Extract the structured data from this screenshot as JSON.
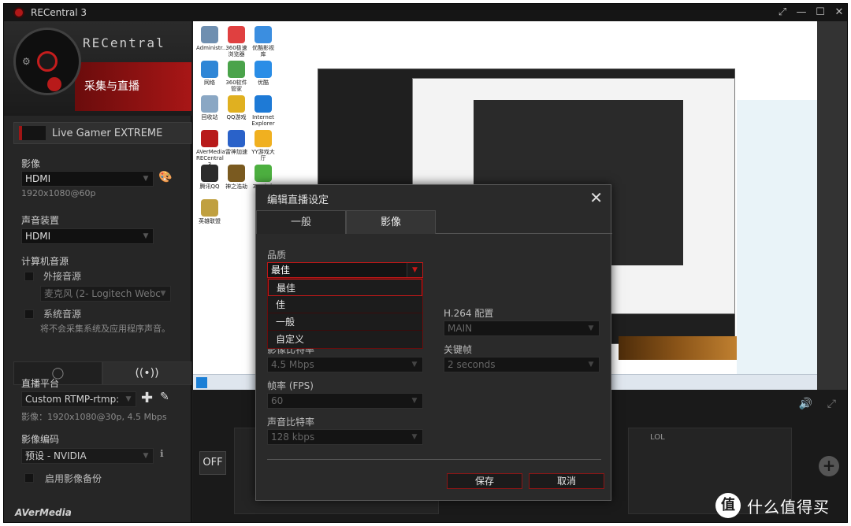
{
  "window": {
    "title": "RECentral 3",
    "controls": [
      "⤢",
      "—",
      "☐",
      "✕"
    ]
  },
  "brand": {
    "logo": "RECentral",
    "subtitle": "采集与直播"
  },
  "device": {
    "name": "Live Gamer EXTREME"
  },
  "left": {
    "video_label": "影像",
    "video_source": "HDMI",
    "video_res": "1920x1080@60p",
    "audio_label": "声音装置",
    "audio_source": "HDMI",
    "pc_audio_label": "计算机音源",
    "ext_audio_label": "外接音源",
    "mic_value": "麦克风 (2- Logitech Webc",
    "sys_audio_label": "系统音源",
    "sys_audio_hint": "将不会采集系统及应用程序声音。",
    "platform_label": "直播平台",
    "platform_value": "Custom RTMP-rtmp:",
    "platform_meta": "影像：1920x1080@30p, 4.5 Mbps",
    "encoder_label": "影像编码",
    "encoder_value": "预设 - NVIDIA",
    "backup_label": "启用影像备份",
    "company": "AVerMedia"
  },
  "desktop": {
    "icons": [
      {
        "label": "Administr...",
        "color": "#6f8fb0"
      },
      {
        "label": "360极速浏览器",
        "color": "#e04040"
      },
      {
        "label": "优酷影视库",
        "color": "#3b8ee0"
      },
      {
        "label": "网络",
        "color": "#2f86d6"
      },
      {
        "label": "360软件管家",
        "color": "#4aa34a"
      },
      {
        "label": "优酷",
        "color": "#2a8de6"
      },
      {
        "label": "回收站",
        "color": "#8aa7c4"
      },
      {
        "label": "QQ游戏",
        "color": "#e0b020"
      },
      {
        "label": "Internet Explorer",
        "color": "#1e7ad6"
      },
      {
        "label": "AVerMedia RECentral 3",
        "color": "#b81a1a"
      },
      {
        "label": "雷神加速",
        "color": "#2a62c9"
      },
      {
        "label": "YY游戏大厅",
        "color": "#f0b020"
      },
      {
        "label": "腾讯QQ",
        "color": "#2c2c2c"
      },
      {
        "label": "神之浩劫",
        "color": "#7a5a20"
      },
      {
        "label": "360安全卫士",
        "color": "#4db040"
      },
      {
        "label": "英雄联盟",
        "color": "#c0a040"
      }
    ]
  },
  "bottom": {
    "off_label": "OFF",
    "lol_label": "LOL"
  },
  "watermark": {
    "glyph": "值",
    "text": "什么值得买"
  },
  "dialog": {
    "title": "编辑直播设定",
    "tabs": [
      {
        "label": "一般"
      },
      {
        "label": "影像"
      }
    ],
    "quality_label": "品质",
    "quality_value": "最佳",
    "quality_options": [
      "最佳",
      "佳",
      "一般",
      "自定义"
    ],
    "h264_label": "H.264 配置",
    "h264_value": "MAIN",
    "bitrate_label": "影像比特率",
    "bitrate_value": "4.5 Mbps",
    "keyframe_label": "关键帧",
    "keyframe_value": "2 seconds",
    "fps_label": "帧率 (FPS)",
    "fps_value": "60",
    "audio_bitrate_label": "声音比特率",
    "audio_bitrate_value": "128 kbps",
    "save_label": "保存",
    "cancel_label": "取消"
  }
}
